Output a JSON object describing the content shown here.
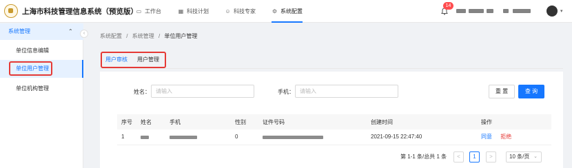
{
  "header": {
    "app_title": "上海市科技管理信息系统（预览版）",
    "nav": [
      {
        "label": "工作台",
        "icon": "monitor-icon"
      },
      {
        "label": "科技计划",
        "icon": "grid-icon"
      },
      {
        "label": "科技专家",
        "icon": "user-icon"
      },
      {
        "label": "系统配置",
        "icon": "gear-icon"
      }
    ],
    "notification_count": "14"
  },
  "sidebar": {
    "group_label": "系统管理",
    "items": [
      {
        "label": "单位信息编辑"
      },
      {
        "label": "单位用户管理"
      },
      {
        "label": "单位机构管理"
      }
    ]
  },
  "breadcrumb": {
    "items": [
      "系统配置",
      "系统管理",
      "单位用户管理"
    ],
    "separator": "/"
  },
  "tabs": [
    {
      "label": "用户审核"
    },
    {
      "label": "用户管理"
    }
  ],
  "filters": {
    "name_label": "姓名：",
    "name_placeholder": "请输入",
    "phone_label": "手机：",
    "phone_placeholder": "请输入",
    "reset_label": "重 置",
    "query_label": "查 询"
  },
  "table": {
    "columns": [
      "序号",
      "姓名",
      "手机",
      "性别",
      "证件号码",
      "创建时间",
      "操作"
    ],
    "rows": [
      {
        "index": "1",
        "gender": "0",
        "created": "2021-09-15 22:47:40",
        "action_agree": "同意",
        "action_reject": "拒绝"
      }
    ]
  },
  "pagination": {
    "summary": "第 1-1 条/总共 1 条",
    "prev": "<",
    "page": "1",
    "next": ">",
    "page_size": "10 条/页"
  },
  "colors": {
    "accent": "#1677ff",
    "danger": "#e53935",
    "highlight_box": "#e53935"
  }
}
